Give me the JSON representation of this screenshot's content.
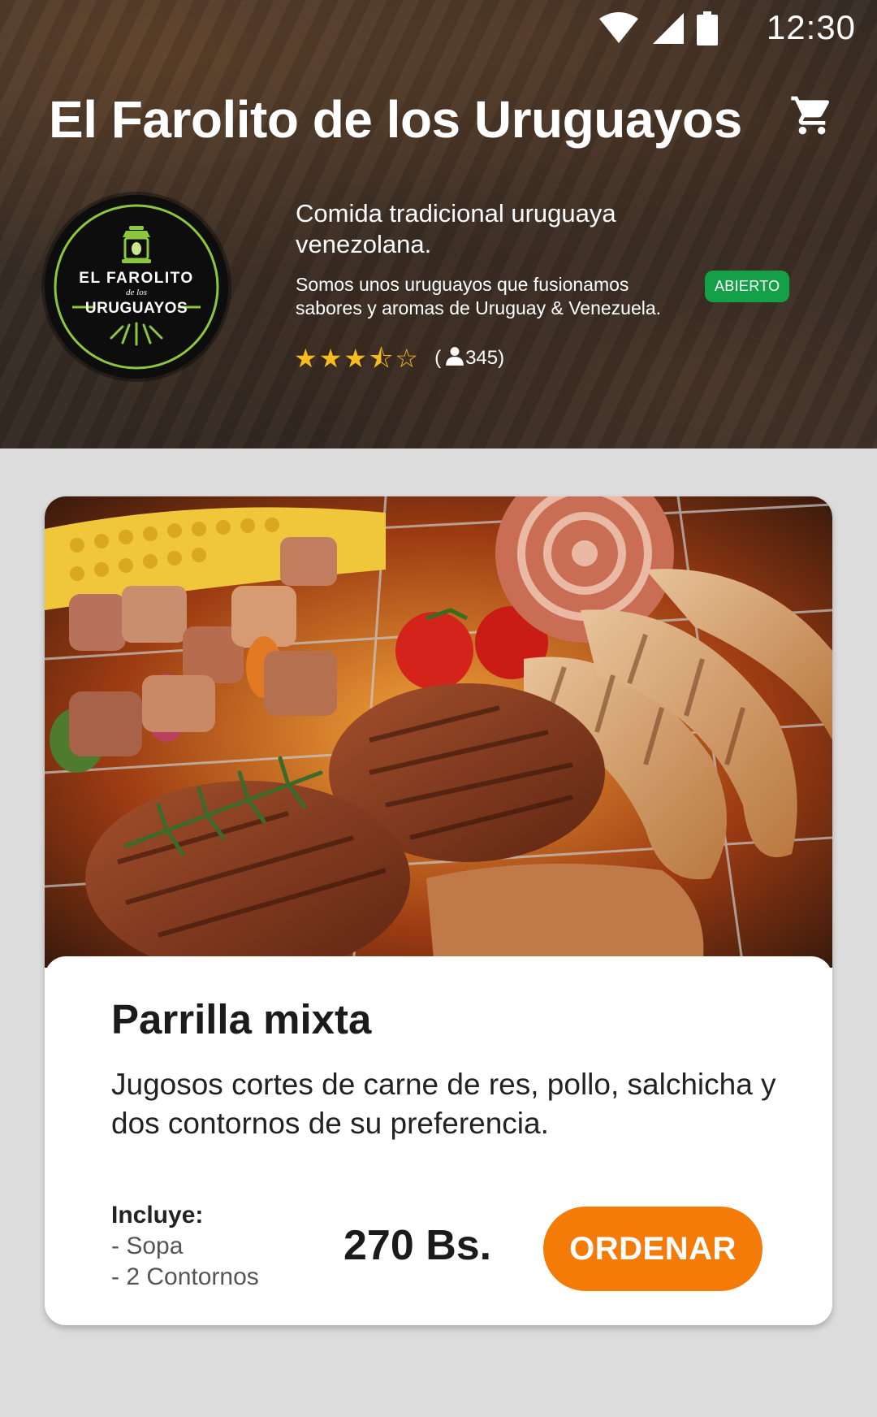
{
  "status_bar": {
    "time": "12:30",
    "icons": [
      "wifi-icon",
      "signal-icon",
      "battery-icon"
    ]
  },
  "header": {
    "title": "El Farolito de los Uruguayos",
    "cart_icon": "shopping-cart-icon",
    "logo_text": {
      "top": "EL FAROLITO",
      "middle": "de los",
      "bottom": "URUGUAYOS"
    },
    "tagline": "Comida tradicional uruguaya venezolana.",
    "description": "Somos unos uruguayos que fusionamos sabores y aromas de Uruguay & Venezuela.",
    "status_badge": "ABIERTO",
    "rating": {
      "value": 3.5,
      "max": 5,
      "open_paren": "(",
      "review_count": "345",
      "close_paren": ")"
    }
  },
  "product": {
    "title": "Parrilla mixta",
    "description": "Jugosos cortes de carne de res, pollo, salchicha y dos contornos de su preferencia.",
    "includes_title": "Incluye:",
    "includes_items": [
      "- Sopa",
      "- 2 Contornos"
    ],
    "price": "270 Bs.",
    "order_label": "ORDENAR"
  },
  "colors": {
    "accent_orange": "#f57b09",
    "badge_green": "#13a046",
    "star_gold": "#f6bb21",
    "logo_green": "#8cc63f",
    "page_background": "#dcdcdc"
  }
}
